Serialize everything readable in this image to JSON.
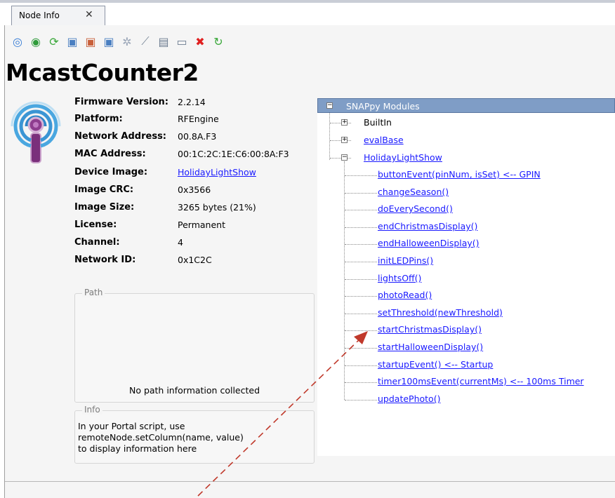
{
  "tab": {
    "label": "Node Info",
    "close_glyph": "✕"
  },
  "toolbar": {
    "buttons": [
      {
        "name": "ping-node-icon",
        "glyph": "◎",
        "color": "#3b7fd6"
      },
      {
        "name": "refresh-node-icon",
        "glyph": "◉",
        "color": "#2f9b3a"
      },
      {
        "name": "sync-arrows-icon",
        "glyph": "⟳",
        "color": "#3aa83a"
      },
      {
        "name": "upload-script-icon",
        "glyph": "▣",
        "color": "#4a7fc1"
      },
      {
        "name": "erase-script-icon",
        "glyph": "▣",
        "color": "#c8603a"
      },
      {
        "name": "export-script-icon",
        "glyph": "▣",
        "color": "#4a7fc1"
      },
      {
        "name": "configure-gear-icon",
        "glyph": "✲",
        "color": "#9aa6b8"
      },
      {
        "name": "probe-icon",
        "glyph": "⟋",
        "color": "#7a8898"
      },
      {
        "name": "copy-icon",
        "glyph": "▤",
        "color": "#6c7c90"
      },
      {
        "name": "field-icon",
        "glyph": "▭",
        "color": "#6c7c90"
      },
      {
        "name": "delete-icon",
        "glyph": "✖",
        "color": "#e02020"
      },
      {
        "name": "reboot-icon",
        "glyph": "↻",
        "color": "#3aa83a"
      }
    ]
  },
  "node": {
    "title": "McastCounter2",
    "fields": [
      {
        "label": "Firmware Version:",
        "value": "2.2.14",
        "link": false
      },
      {
        "label": "Platform:",
        "value": "RFEngine",
        "link": false
      },
      {
        "label": "Network Address:",
        "value": "00.8A.F3",
        "link": false
      },
      {
        "label": "MAC Address:",
        "value": "00:1C:2C:1E:C6:00:8A:F3",
        "link": false
      },
      {
        "label": "Device Image:",
        "value": "HolidayLightShow",
        "link": true
      },
      {
        "label": "Image CRC:",
        "value": "0x3566",
        "link": false
      },
      {
        "label": "Image Size:",
        "value": "3265 bytes (21%)",
        "link": false
      },
      {
        "label": "License:",
        "value": "Permanent",
        "link": false
      },
      {
        "label": "Channel:",
        "value": "4",
        "link": false
      },
      {
        "label": "Network ID:",
        "value": "0x1C2C",
        "link": false
      }
    ]
  },
  "path": {
    "legend": "Path",
    "message": "No path information collected"
  },
  "info": {
    "legend": "Info",
    "lines": [
      "In your Portal script, use",
      "remoteNode.setColumn(name, value)",
      "to display information here"
    ]
  },
  "tree": {
    "root": "SNAPpy Modules",
    "modules": [
      {
        "label": "BuiltIn",
        "link": false,
        "expanded": false
      },
      {
        "label": "evalBase",
        "link": true,
        "expanded": false
      },
      {
        "label": "HolidayLightShow",
        "link": true,
        "expanded": true
      }
    ],
    "functions": [
      "buttonEvent(pinNum, isSet) <-- GPIN",
      "changeSeason()",
      "doEverySecond()",
      "endChristmasDisplay()",
      "endHalloweenDisplay()",
      "initLEDPins()",
      "lightsOff()",
      "photoRead()",
      "setThreshold(newThreshold)",
      "startChristmasDisplay()",
      "startHalloweenDisplay()",
      "startupEvent() <-- Startup",
      "timer100msEvent(currentMs) <-- 100ms Timer",
      "updatePhoto()"
    ]
  },
  "colors": {
    "link": "#1a1aff",
    "tree_header": "#7f9dc6",
    "annotation_arrow": "#c0392b"
  }
}
